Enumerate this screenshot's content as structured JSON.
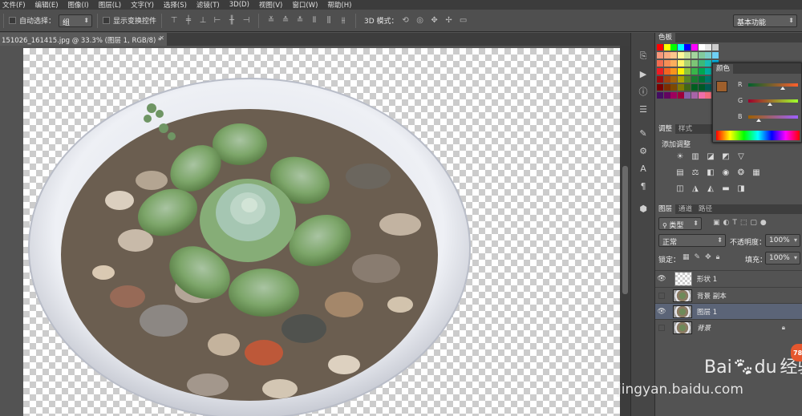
{
  "menubar": {
    "items": [
      "文件(F)",
      "编辑(E)",
      "图像(I)",
      "图层(L)",
      "文字(Y)",
      "选择(S)",
      "滤镜(T)",
      "3D(D)",
      "视图(V)",
      "窗口(W)",
      "帮助(H)"
    ]
  },
  "options": {
    "auto_select_label": "自动选择：",
    "auto_select_value": "组",
    "show_transform_label": "显示变换控件",
    "mode_3d_label": "3D 模式：",
    "workspace_value": "基本功能"
  },
  "document": {
    "tab_title": "151026_161415.jpg @ 33.3% (图层 1, RGB/8) *"
  },
  "panels": {
    "swatches_tab": "色板",
    "color_tab": "颜色",
    "channel_r": "R",
    "channel_g": "G",
    "channel_b": "B",
    "adjust_tab": "调整",
    "styles_tab": "样式",
    "add_adjustment": "添加调整",
    "layers_tab": "图层",
    "channels_tab": "通道",
    "paths_tab": "路径",
    "kind_filter": "类型",
    "blend_mode": "正常",
    "opacity_label": "不透明度：",
    "opacity_value": "100%",
    "lock_label": "锁定：",
    "fill_label": "填充：",
    "fill_value": "100%",
    "layers": [
      {
        "name": "形状 1",
        "visible": true
      },
      {
        "name": "背景 副本",
        "visible": false
      },
      {
        "name": "图层 1",
        "visible": true,
        "selected": true
      },
      {
        "name": "背景",
        "visible": false,
        "locked": true
      }
    ]
  },
  "colors": {
    "foreground": "#9e5f2c",
    "accent_selected_layer": "#5b6477",
    "watermark_badge": "#e5572e"
  },
  "watermark": {
    "badge": "78",
    "brand": "Bai",
    "brand2": "du",
    "jingyan": "经验",
    "url": "jingyan.baidu.com"
  }
}
